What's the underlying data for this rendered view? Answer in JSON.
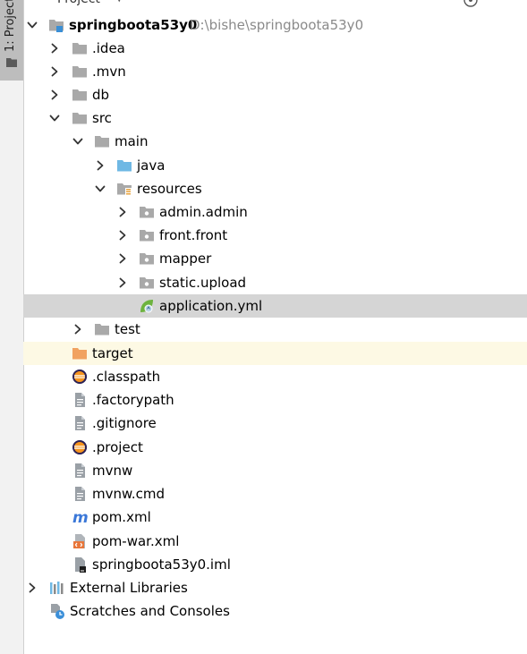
{
  "toolwindow": {
    "stripe_label": "1: Project",
    "header_title": "Project"
  },
  "colors": {
    "selected_row": "#d5d5d5",
    "excluded_row": "#fdf9e4",
    "folder_gray": "#a9a9a9",
    "folder_blue": "#6fb8e4",
    "folder_orange": "#f1a260"
  },
  "tree": {
    "root": {
      "name": "springboota53y0",
      "path": "D:\\bishe\\springboota53y0",
      "icon": "module-folder-icon"
    },
    "idea": {
      "name": ".idea",
      "icon": "folder-icon"
    },
    "mvn": {
      "name": ".mvn",
      "icon": "folder-icon"
    },
    "db": {
      "name": "db",
      "icon": "folder-icon"
    },
    "src": {
      "name": "src",
      "icon": "folder-icon"
    },
    "main": {
      "name": "main",
      "icon": "folder-icon"
    },
    "java": {
      "name": "java",
      "icon": "source-folder-icon"
    },
    "resources": {
      "name": "resources",
      "icon": "resources-folder-icon"
    },
    "admin_admin": {
      "name": "admin.admin",
      "icon": "package-icon"
    },
    "front_front": {
      "name": "front.front",
      "icon": "package-icon"
    },
    "mapper": {
      "name": "mapper",
      "icon": "package-icon"
    },
    "static_upload": {
      "name": "static.upload",
      "icon": "package-icon"
    },
    "application_yml": {
      "name": "application.yml",
      "icon": "spring-config-icon"
    },
    "test": {
      "name": "test",
      "icon": "folder-icon"
    },
    "target": {
      "name": "target",
      "icon": "excluded-folder-icon"
    },
    "classpath": {
      "name": ".classpath",
      "icon": "eclipse-icon"
    },
    "factorypath": {
      "name": ".factorypath",
      "icon": "text-file-icon"
    },
    "gitignore": {
      "name": ".gitignore",
      "icon": "text-file-icon"
    },
    "project": {
      "name": ".project",
      "icon": "eclipse-icon"
    },
    "mvnw": {
      "name": "mvnw",
      "icon": "text-file-icon"
    },
    "mvnw_cmd": {
      "name": "mvnw.cmd",
      "icon": "text-file-icon"
    },
    "pom_xml": {
      "name": "pom.xml",
      "icon": "maven-icon"
    },
    "pom_war_xml": {
      "name": "pom-war.xml",
      "icon": "xml-file-icon"
    },
    "iml": {
      "name": "springboota53y0.iml",
      "icon": "iml-file-icon"
    },
    "external_libraries": {
      "name": "External Libraries",
      "icon": "libraries-icon"
    },
    "scratches": {
      "name": "Scratches and Consoles",
      "icon": "scratches-icon"
    }
  }
}
